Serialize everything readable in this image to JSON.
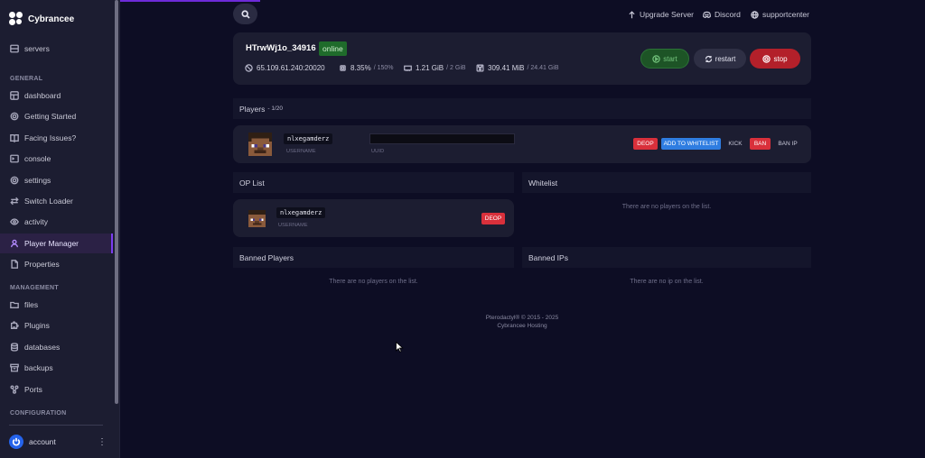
{
  "brand": {
    "name": "Cybrancee"
  },
  "sidebar": {
    "top_item": {
      "label": "servers",
      "icon": "server-icon"
    },
    "sections": {
      "general": "GENERAL",
      "management": "MANAGEMENT",
      "configuration": "CONFIGURATION"
    },
    "general_items": [
      {
        "label": "dashboard",
        "icon": "dashboard-icon"
      },
      {
        "label": "Getting Started",
        "icon": "gear-icon"
      },
      {
        "label": "Facing Issues?",
        "icon": "book-icon"
      },
      {
        "label": "console",
        "icon": "terminal-icon"
      },
      {
        "label": "settings",
        "icon": "gear-icon"
      },
      {
        "label": "Switch Loader",
        "icon": "swap-icon"
      },
      {
        "label": "activity",
        "icon": "eye-icon"
      },
      {
        "label": "Player Manager",
        "icon": "user-icon",
        "active": true
      },
      {
        "label": "Properties",
        "icon": "file-icon"
      }
    ],
    "management_items": [
      {
        "label": "files",
        "icon": "folder-icon"
      },
      {
        "label": "Plugins",
        "icon": "puzzle-icon"
      },
      {
        "label": "databases",
        "icon": "database-icon"
      },
      {
        "label": "backups",
        "icon": "archive-icon"
      },
      {
        "label": "Ports",
        "icon": "network-icon"
      }
    ],
    "account": {
      "label": "account",
      "menu": "⋮"
    }
  },
  "topbar": {
    "links": [
      {
        "label": "Upgrade Server",
        "icon": "arrow-up-icon"
      },
      {
        "label": "Discord",
        "icon": "discord-icon"
      },
      {
        "label": "supportcenter",
        "icon": "globe-icon"
      }
    ]
  },
  "server": {
    "name": "HTrwWj1o_34916",
    "status": "online",
    "address": "65.109.61.240:20020",
    "cpu": "8.35%",
    "cpu_limit": "/ 150%",
    "memory": "1.21 GiB",
    "memory_limit": "/ 2 GiB",
    "disk": "309.41 MiB",
    "disk_limit": "/ 24.41 GiB",
    "actions": {
      "start": "start",
      "restart": "restart",
      "stop": "stop"
    }
  },
  "players": {
    "title": "Players",
    "count": "- 1/20",
    "list": [
      {
        "username": "nlxegamderz",
        "username_label": "USERNAME",
        "uuid_label": "UUID",
        "actions": {
          "deop": "DEOP",
          "whitelist": "ADD TO WHITELIST",
          "kick": "KICK",
          "ban": "BAN",
          "ban_ip": "BAN IP"
        }
      }
    ]
  },
  "op_list": {
    "title": "OP List",
    "entries": [
      {
        "username": "nlxegamderz",
        "username_label": "USERNAME",
        "action": "DEOP"
      }
    ]
  },
  "whitelist": {
    "title": "Whitelist",
    "empty": "There are no players on the list."
  },
  "banned_players": {
    "title": "Banned Players",
    "empty": "There are no players on the list."
  },
  "banned_ips": {
    "title": "Banned IPs",
    "empty": "There are no ip on the list."
  },
  "footer": {
    "line1": "Pterodactyl® © 2015 - 2025",
    "line2": "Cybrancee Hosting"
  },
  "colors": {
    "accent": "#7b3df0",
    "online": "#1f6b2b",
    "danger": "#d9303b",
    "primary": "#2f7de1"
  }
}
